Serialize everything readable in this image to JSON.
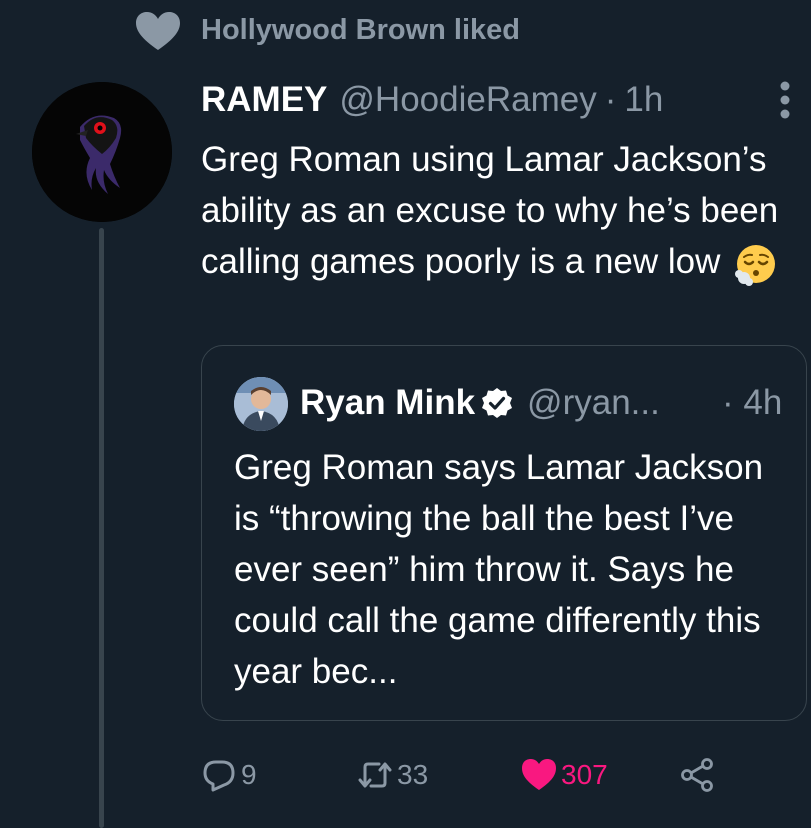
{
  "social_context": {
    "icon": "heart-icon",
    "text": "Hollywood Brown liked"
  },
  "tweet": {
    "author_name": "RAMEY",
    "handle": "@HoodieRamey",
    "separator": "·",
    "time": "1h",
    "text": "Greg Roman using Lamar Jackson’s ability as an excuse to why he’s been calling games poorly is a new low",
    "emoji": "face-exhaling-emoji"
  },
  "quoted": {
    "author_name": "Ryan Mink",
    "verified": true,
    "handle": "@ryan...",
    "time": "· 4h",
    "text": "Greg Roman says Lamar Jackson is “throwing the ball the best I’ve ever seen” him throw it. Says he could call the game differently this year bec..."
  },
  "actions": {
    "replies": "9",
    "retweets": "33",
    "likes": "307"
  },
  "colors": {
    "background": "#15202b",
    "secondary_text": "#8b98a5",
    "border": "#38444d",
    "like": "#f91880",
    "verified_badge": "#ffffff"
  }
}
